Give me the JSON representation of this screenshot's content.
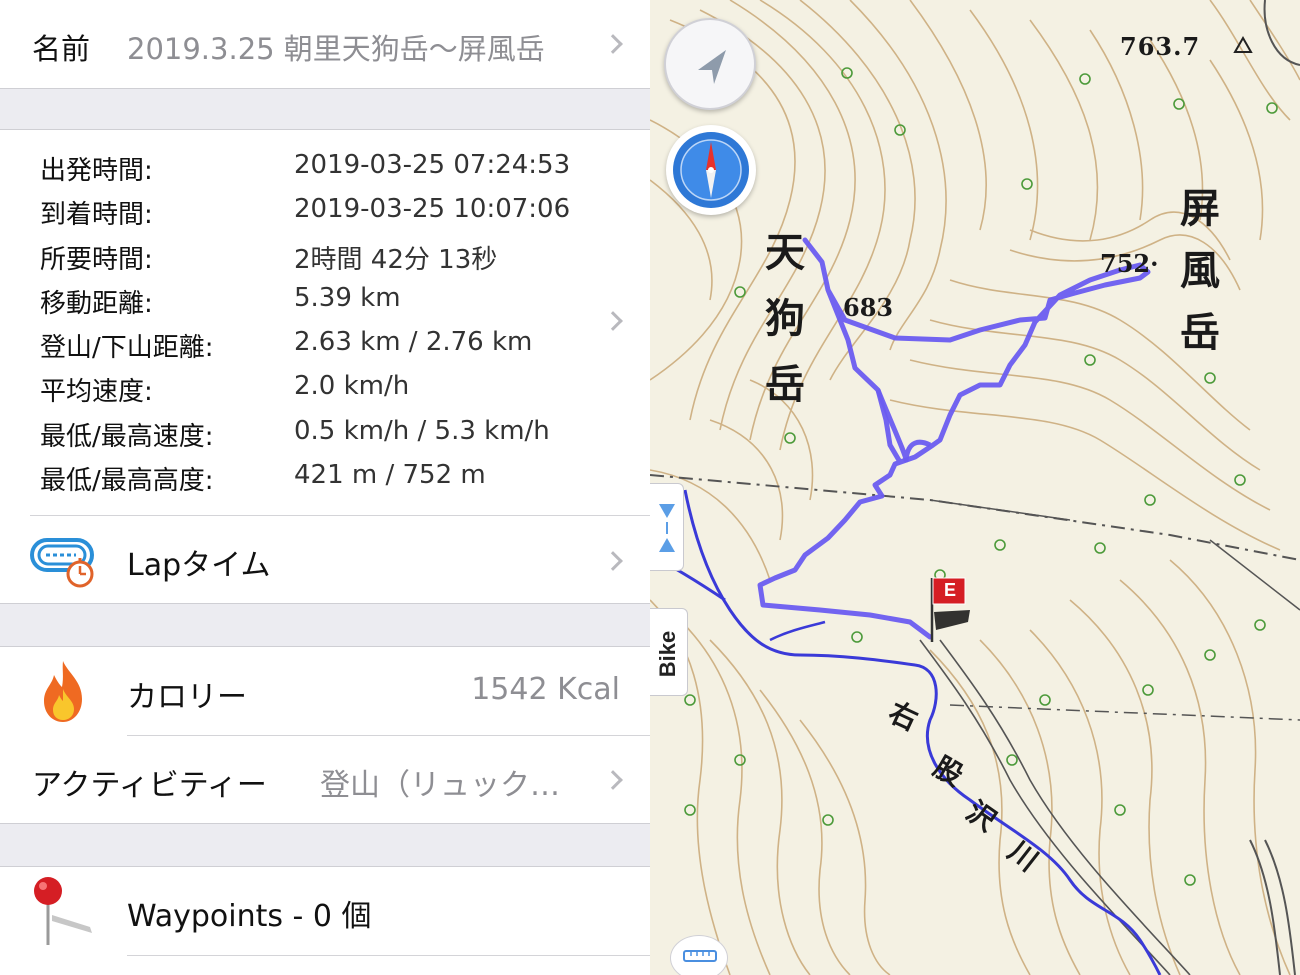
{
  "header": {
    "name_label": "名前",
    "name_value": "2019.3.25 朝里天狗岳〜屏風岳"
  },
  "stats": [
    {
      "key": "出発時間:",
      "value": "2019-03-25 07:24:53"
    },
    {
      "key": "到着時間:",
      "value": "2019-03-25 10:07:06"
    },
    {
      "key": "所要時間:",
      "value": "2時間 42分 13秒"
    },
    {
      "key": "移動距離:",
      "value": "5.39 km"
    },
    {
      "key": "登山/下山距離:",
      "value": "2.63 km / 2.76 km"
    },
    {
      "key": "平均速度:",
      "value": "2.0 km/h"
    },
    {
      "key": "最低/最高速度:",
      "value": "0.5 km/h / 5.3 km/h"
    },
    {
      "key": "最低/最高高度:",
      "value": "421 m / 752 m"
    }
  ],
  "lap": {
    "label": "Lapタイム"
  },
  "calorie": {
    "label": "カロリー",
    "value": "1542 Kcal"
  },
  "activity": {
    "label": "アクティビティー",
    "value": "登山（リュック…"
  },
  "waypoints": {
    "label": "Waypoints - 0 個"
  },
  "map": {
    "summit_763": "763.7",
    "summit_752": "752·",
    "summit_683": "683",
    "peak_tengu": [
      "天",
      "狗",
      "岳"
    ],
    "peak_byobu": [
      "屏",
      "風",
      "岳"
    ],
    "river": [
      "右",
      "股",
      "沢",
      "川"
    ],
    "end_flag": "E",
    "bike_tab": "Bike",
    "track_color": "#6a5cf0",
    "river_color": "#3a3ad8"
  },
  "icons": {
    "header_chevron": "chevron-right-icon",
    "locate": "location-arrow-icon",
    "compass": "compass-icon",
    "lap": "stopwatch-icon",
    "calorie": "flame-icon",
    "waypoint": "pin-icon",
    "ruler": "ruler-icon"
  }
}
